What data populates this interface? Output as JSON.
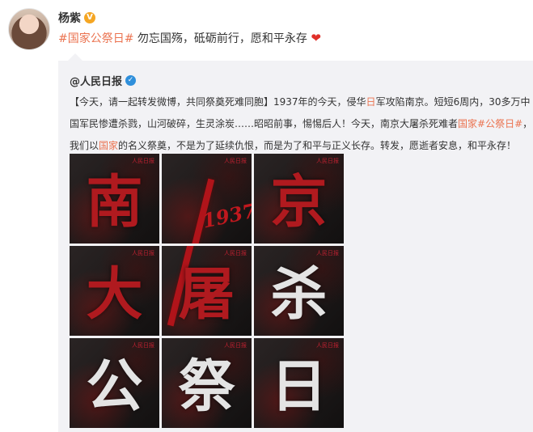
{
  "post": {
    "username": "杨紫",
    "vip_badge": "V",
    "hashtag": "#国家公祭日#",
    "text": " 勿忘国殇，砥砺前行，愿和平永存",
    "heart": "❤"
  },
  "repost": {
    "source": "@人民日报",
    "verified_badge": "✓",
    "line1_a": "【今天，请一起转发微博，共同祭奠死难同胞】1937年的今天，侵华",
    "line1_red": "日",
    "line1_b": "军攻陷南京。短短6周内，30多万中",
    "line2_a": "国军民惨遭杀戮，山河破碎，生灵涂炭……昭昭前事，惕惕后人！今天，南京大屠杀死难者",
    "line2_red": "国家#公祭日#",
    "line2_b": "，",
    "line3_a": "我们以",
    "line3_red": "国家",
    "line3_b": "的名义祭奠，不是为了延续仇恨，而是为了和平与正义长存。转发，愿逝者安息，和平永存！"
  },
  "images": {
    "logo": "人民日报",
    "year": "1937",
    "tiles": [
      "南",
      "",
      "京",
      "大",
      "屠",
      "杀",
      "公",
      "祭",
      "日"
    ]
  },
  "colors": {
    "hashtag": "#eb7350",
    "repost_bg": "#f2f2f5",
    "accent_red": "#b01a1f"
  }
}
